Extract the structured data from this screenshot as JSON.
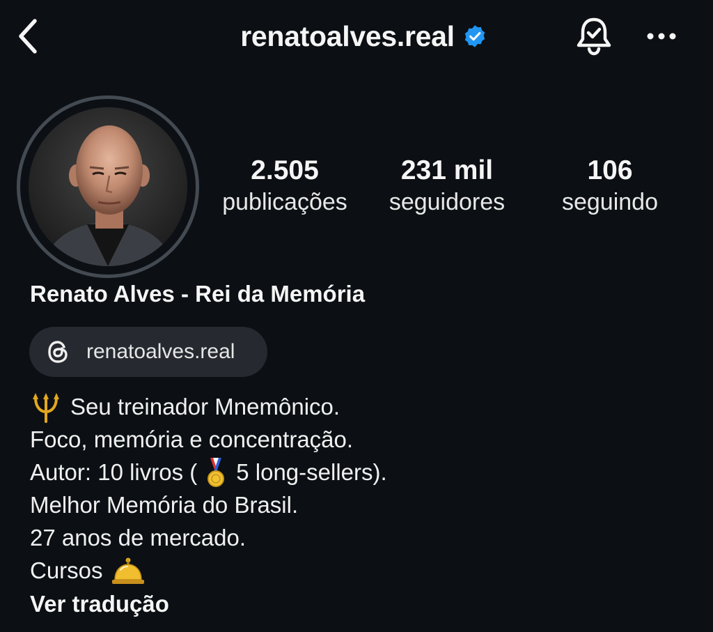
{
  "header": {
    "username": "renatoalves.real",
    "back_icon": "chevron-left-icon",
    "verified_icon": "verified-badge-icon",
    "bell_icon": "notification-bell-check-icon",
    "more_icon": "more-horizontal-icon"
  },
  "profile": {
    "avatar_icon": "profile-photo",
    "stats": [
      {
        "value": "2.505",
        "label": "publicações"
      },
      {
        "value": "231 mil",
        "label": "seguidores"
      },
      {
        "value": "106",
        "label": "seguindo"
      }
    ],
    "full_name": "Renato Alves - Rei da Memória",
    "threads": {
      "icon": "threads-icon",
      "handle": "renatoalves.real"
    },
    "bio": {
      "line1": "Seu treinador Mnemônico.",
      "line2": "Foco, memória e concentração.",
      "line3_a": "Autor: 10 livros (",
      "line3_b": "5 long-sellers).",
      "line4": "Melhor Memória do Brasil.",
      "line5": "27 anos de mercado.",
      "line6": "Cursos",
      "emoji_1": "trident-emoji",
      "emoji_2": "medal-emoji",
      "emoji_3": "bellhop-bell-emoji"
    },
    "translate_label": "Ver tradução"
  },
  "colors": {
    "background": "#0c1014",
    "verified_blue": "#2196f3",
    "pill_bg": "#262a30",
    "avatar_ring": "#444a52"
  }
}
